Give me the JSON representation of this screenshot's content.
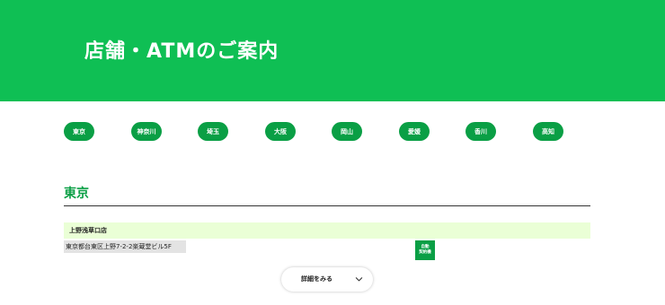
{
  "header": {
    "title": "店舗・ATMのご案内",
    "background_color": "#0fbf54"
  },
  "region_nav": {
    "items": [
      {
        "label": "東京",
        "name": "tokyo"
      },
      {
        "label": "神奈川",
        "name": "kanagawa"
      },
      {
        "label": "埼玉",
        "name": "saitama"
      },
      {
        "label": "大阪",
        "name": "osaka"
      },
      {
        "label": "岡山",
        "name": "okayama"
      },
      {
        "label": "愛媛",
        "name": "ehime"
      },
      {
        "label": "香川",
        "name": "kagawa"
      },
      {
        "label": "高知",
        "name": "kochi"
      }
    ],
    "pill_color": "#0a9f45"
  },
  "section": {
    "title": "東京",
    "accent_color": "#0a9f45"
  },
  "store": {
    "name": "上野浅草口店",
    "address": "東京都台東区上野7-2-2楽蔵堂ビル5F",
    "badge": {
      "line1": "自動",
      "line2": "契約機"
    }
  },
  "details_button": {
    "label": "詳細をみる",
    "icon": "chevron-down-icon"
  }
}
